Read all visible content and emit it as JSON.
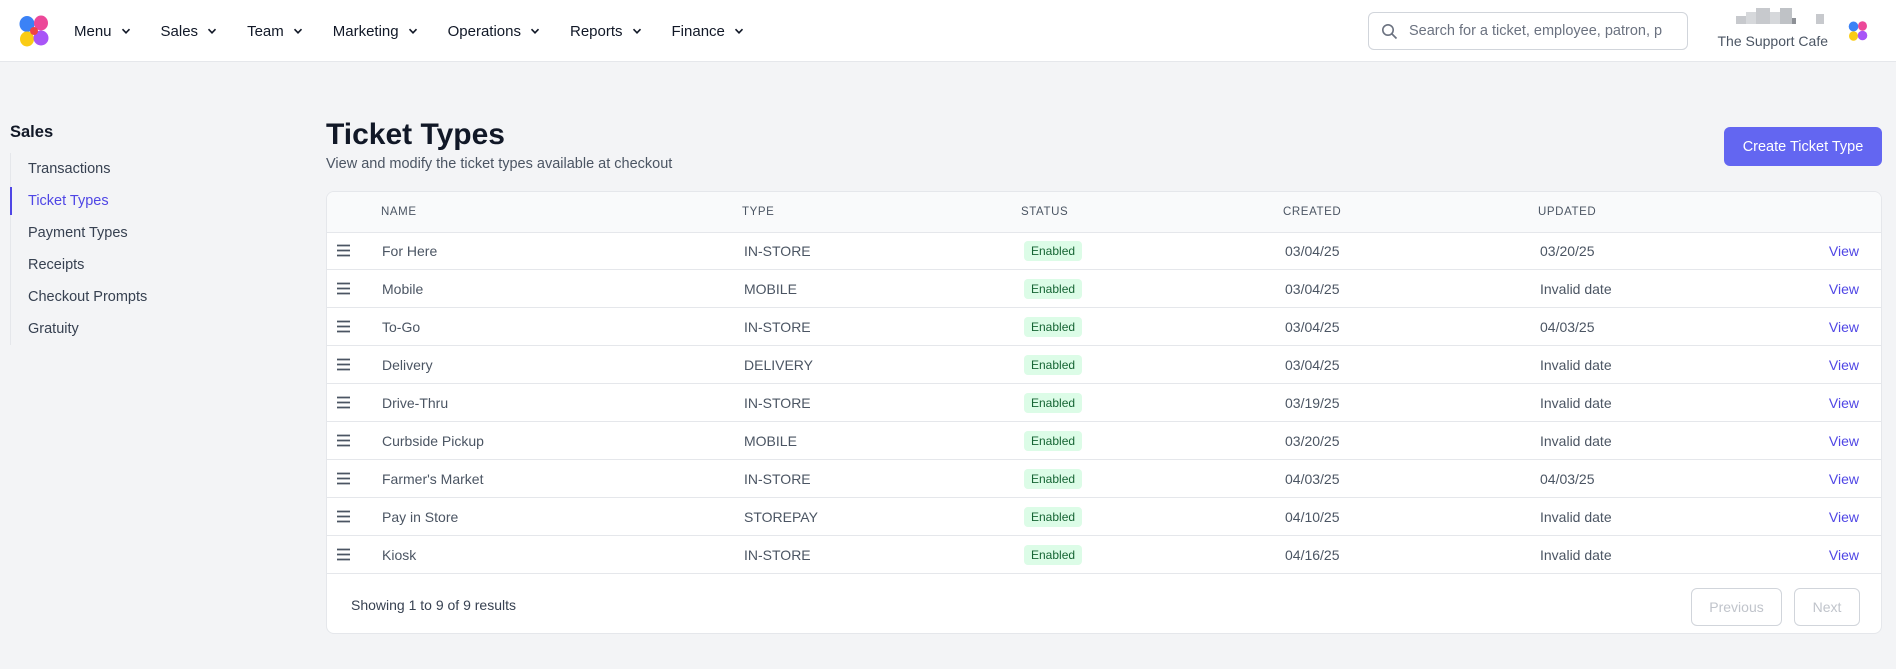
{
  "nav": {
    "items": [
      {
        "label": "Menu"
      },
      {
        "label": "Sales"
      },
      {
        "label": "Team"
      },
      {
        "label": "Marketing"
      },
      {
        "label": "Operations"
      },
      {
        "label": "Reports"
      },
      {
        "label": "Finance"
      }
    ],
    "search_placeholder": "Search for a ticket, employee, patron, p",
    "account_name": "The Support Cafe"
  },
  "sidebar": {
    "title": "Sales",
    "items": [
      {
        "label": "Transactions",
        "active": false
      },
      {
        "label": "Ticket Types",
        "active": true
      },
      {
        "label": "Payment Types",
        "active": false
      },
      {
        "label": "Receipts",
        "active": false
      },
      {
        "label": "Checkout Prompts",
        "active": false
      },
      {
        "label": "Gratuity",
        "active": false
      }
    ]
  },
  "page": {
    "title": "Ticket Types",
    "subtitle": "View and modify the ticket types available at checkout",
    "create_button": "Create Ticket Type"
  },
  "table": {
    "headers": {
      "name": "NAME",
      "type": "TYPE",
      "status": "STATUS",
      "created": "CREATED",
      "updated": "UPDATED"
    },
    "rows": [
      {
        "name": "For Here",
        "type": "IN-STORE",
        "status": "Enabled",
        "created": "03/04/25",
        "updated": "03/20/25",
        "action": "View"
      },
      {
        "name": "Mobile",
        "type": "MOBILE",
        "status": "Enabled",
        "created": "03/04/25",
        "updated": "Invalid date",
        "action": "View"
      },
      {
        "name": "To-Go",
        "type": "IN-STORE",
        "status": "Enabled",
        "created": "03/04/25",
        "updated": "04/03/25",
        "action": "View"
      },
      {
        "name": "Delivery",
        "type": "DELIVERY",
        "status": "Enabled",
        "created": "03/04/25",
        "updated": "Invalid date",
        "action": "View"
      },
      {
        "name": "Drive-Thru",
        "type": "IN-STORE",
        "status": "Enabled",
        "created": "03/19/25",
        "updated": "Invalid date",
        "action": "View"
      },
      {
        "name": "Curbside Pickup",
        "type": "MOBILE",
        "status": "Enabled",
        "created": "03/20/25",
        "updated": "Invalid date",
        "action": "View"
      },
      {
        "name": "Farmer's Market",
        "type": "IN-STORE",
        "status": "Enabled",
        "created": "04/03/25",
        "updated": "04/03/25",
        "action": "View"
      },
      {
        "name": "Pay in Store",
        "type": "STOREPAY",
        "status": "Enabled",
        "created": "04/10/25",
        "updated": "Invalid date",
        "action": "View"
      },
      {
        "name": "Kiosk",
        "type": "IN-STORE",
        "status": "Enabled",
        "created": "04/16/25",
        "updated": "Invalid date",
        "action": "View"
      }
    ]
  },
  "pagination": {
    "summary": "Showing 1 to 9 of 9 results",
    "previous": "Previous",
    "next": "Next"
  },
  "colors": {
    "accent": "#6366f1",
    "link": "#4f46e5",
    "badge_bg": "#dcfce7",
    "badge_text": "#166534"
  }
}
